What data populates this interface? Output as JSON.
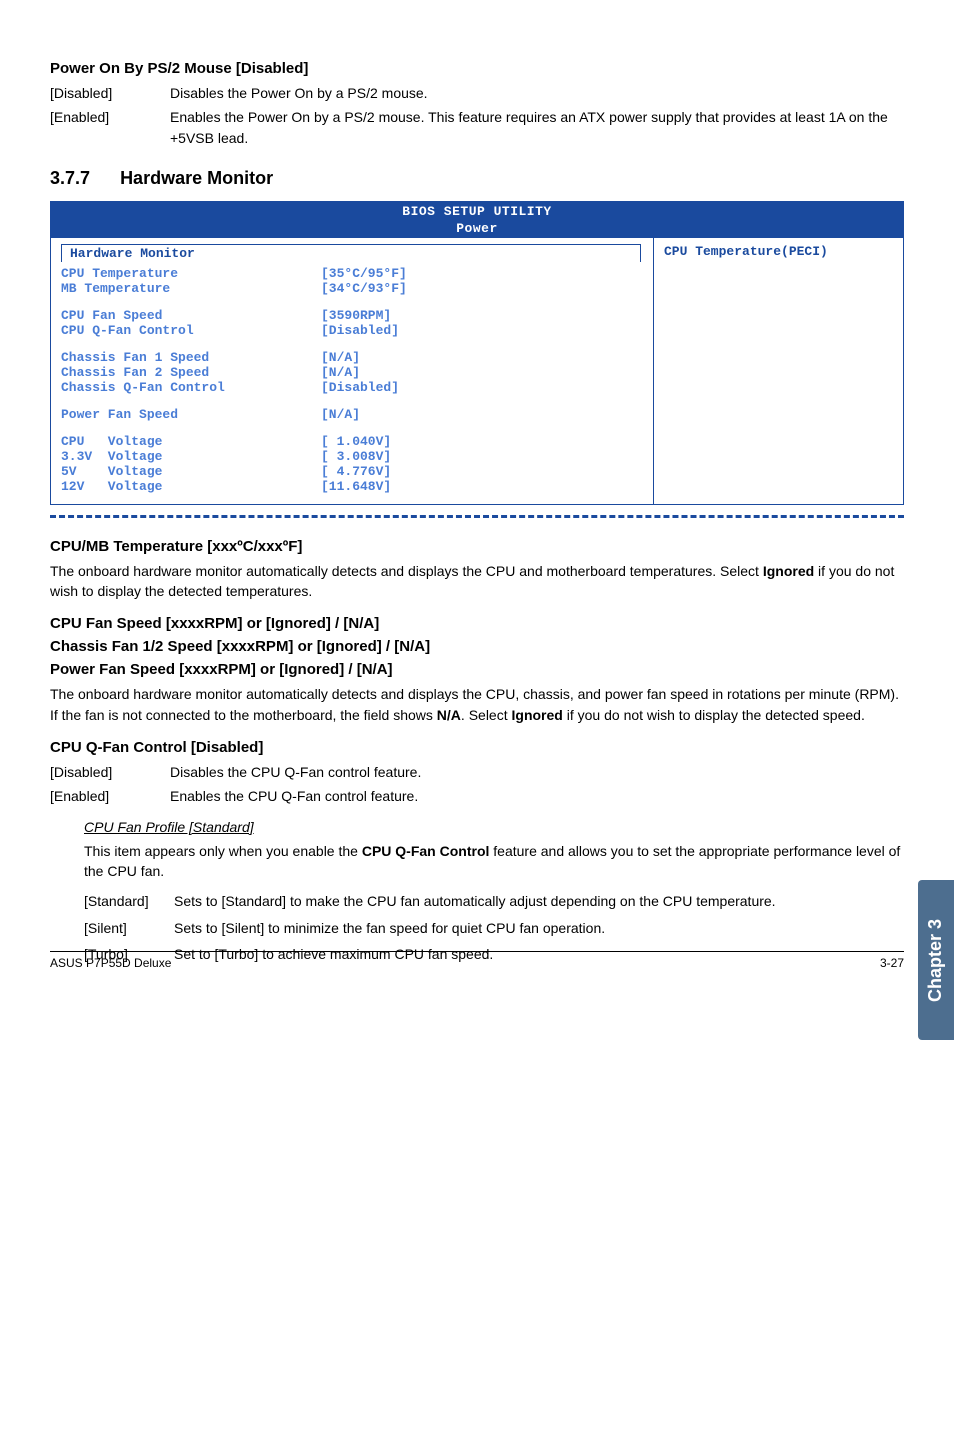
{
  "sec1": {
    "title": "Power On By PS/2 Mouse [Disabled]",
    "rows": [
      {
        "term": "[Disabled]",
        "desc": "Disables the Power On by a PS/2 mouse."
      },
      {
        "term": "[Enabled]",
        "desc": "Enables the Power On by a PS/2 mouse. This feature requires an ATX power supply that provides at least 1A on the +5VSB lead."
      }
    ]
  },
  "sec377": {
    "num": "3.7.7",
    "title": "Hardware Monitor"
  },
  "bios": {
    "title": "BIOS SETUP UTILITY",
    "tab": "Power",
    "header": "Hardware Monitor",
    "right": "CPU Temperature(PECI)",
    "groups": [
      [
        {
          "label": "CPU Temperature",
          "val": "[35°C/95°F]"
        },
        {
          "label": "MB Temperature",
          "val": "[34°C/93°F]"
        }
      ],
      [
        {
          "label": "CPU Fan Speed",
          "val": "[3590RPM]"
        },
        {
          "label": "CPU Q-Fan Control",
          "val": "[Disabled]"
        }
      ],
      [
        {
          "label": "Chassis Fan 1 Speed",
          "val": "[N/A]"
        },
        {
          "label": "Chassis Fan 2 Speed",
          "val": "[N/A]"
        },
        {
          "label": "Chassis Q-Fan Control",
          "val": "[Disabled]"
        }
      ],
      [
        {
          "label": "Power Fan Speed",
          "val": "[N/A]"
        }
      ],
      [
        {
          "label": "CPU   Voltage",
          "val": "[ 1.040V]"
        },
        {
          "label": "3.3V  Voltage",
          "val": "[ 3.008V]"
        },
        {
          "label": "5V    Voltage",
          "val": "[ 4.776V]"
        },
        {
          "label": "12V   Voltage",
          "val": "[11.648V]"
        }
      ]
    ]
  },
  "cpumb": {
    "title": "CPU/MB Temperature [xxxºC/xxxºF]",
    "body_a": "The onboard hardware monitor automatically detects and displays the CPU and motherboard temperatures. Select ",
    "body_bold": "Ignored",
    "body_b": " if you do not wish to display the detected temperatures."
  },
  "fanspeed": {
    "t1": "CPU Fan Speed [xxxxRPM] or [Ignored] / [N/A]",
    "t2": "Chassis Fan 1/2 Speed [xxxxRPM] or [Ignored] / [N/A]",
    "t3": "Power Fan Speed [xxxxRPM] or [Ignored] / [N/A]",
    "body_a": "The onboard hardware monitor automatically detects and displays the CPU, chassis, and power fan speed in rotations per minute (RPM). If the fan is not connected to the motherboard, the field shows ",
    "body_bold1": "N/A",
    "body_mid": ". Select ",
    "body_bold2": "Ignored",
    "body_b": " if you do not wish to display the detected speed."
  },
  "qfan": {
    "title": "CPU Q-Fan Control [Disabled]",
    "rows": [
      {
        "term": "[Disabled]",
        "desc": "Disables the CPU Q-Fan control feature."
      },
      {
        "term": "[Enabled]",
        "desc": "Enables the CPU Q-Fan control feature."
      }
    ],
    "profile_title": "CPU Fan Profile [Standard]",
    "profile_body_a": "This item appears only when you enable the ",
    "profile_bold": "CPU Q-Fan Control",
    "profile_body_b": " feature and allows you to set the appropriate performance level of the CPU fan.",
    "opts": [
      {
        "term": "[Standard]",
        "desc": "Sets to [Standard] to make the CPU fan automatically adjust depending on the CPU temperature."
      },
      {
        "term": "[Silent]",
        "desc": "Sets to [Silent] to minimize the fan speed for quiet CPU fan operation."
      },
      {
        "term": "[Turbo]",
        "desc": "Set to [Turbo] to achieve maximum CPU fan speed."
      }
    ]
  },
  "sidetab": "Chapter 3",
  "footer": {
    "left": "ASUS P7P55D Deluxe",
    "right": "3-27"
  }
}
